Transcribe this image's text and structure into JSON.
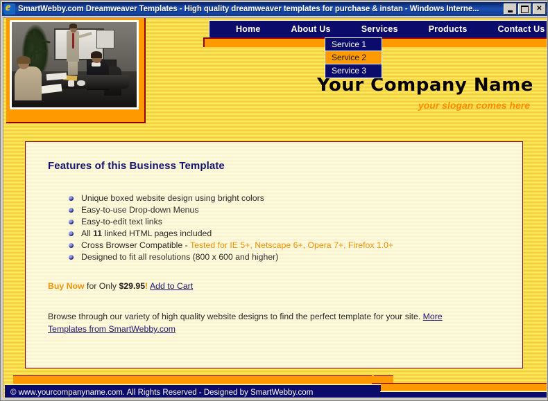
{
  "window": {
    "title": "SmartWebby.com Dreamweaver Templates - High quality dreamweaver templates for purchase & instan - Windows Interne...",
    "icon": "internet-explorer-icon",
    "buttons": {
      "minimize": "_",
      "maximize": "□",
      "close": "✕"
    }
  },
  "header": {
    "company_name": "Your Company Name",
    "slogan": "your slogan comes here",
    "photo_alt": "business-meeting-photo"
  },
  "nav": {
    "items": [
      {
        "label": "Home"
      },
      {
        "label": "About Us"
      },
      {
        "label": "Services"
      },
      {
        "label": "Products"
      },
      {
        "label": "Contact Us"
      }
    ],
    "dropdown": {
      "parent": "Services",
      "items": [
        {
          "label": "Service 1",
          "highlighted": false
        },
        {
          "label": "Service 2",
          "highlighted": true
        },
        {
          "label": "Service 3",
          "highlighted": false
        }
      ]
    }
  },
  "content": {
    "heading": "Features of this Business Template",
    "features": [
      {
        "text": "Unique boxed website design using bright colors"
      },
      {
        "text": "Easy-to-use Drop-down Menus"
      },
      {
        "text": "Easy-to-edit text links"
      },
      {
        "pre": "All ",
        "bold": "11",
        "post": " linked HTML pages included"
      },
      {
        "pre": "Cross Browser Compatible - ",
        "orange": "Tested for IE 5+, Netscape 6+, Opera 7+, Firefox 1.0+"
      },
      {
        "text": "Designed to fit all resolutions (800 x 600 and higher)"
      }
    ],
    "buy": {
      "buy_now": "Buy Now",
      "for_only": " for Only ",
      "price": "$29.95",
      "exclamation": "!",
      "add_to_cart": "Add to Cart"
    },
    "browse": {
      "text": "Browse through our variety of high quality website designs to find the perfect template for your site. ",
      "link": "More Templates from SmartWebby.com"
    }
  },
  "footer": {
    "text": "© www.yourcompanyname.com. All Rights Reserved - Designed by SmartWebby.com"
  },
  "colors": {
    "navy": "#0b0b6b",
    "orange": "#ff9900",
    "maroon": "#8b0000",
    "yellow": "#ffd11a",
    "cream": "#fdf3c8",
    "accent_orange_text": "#f39200"
  }
}
